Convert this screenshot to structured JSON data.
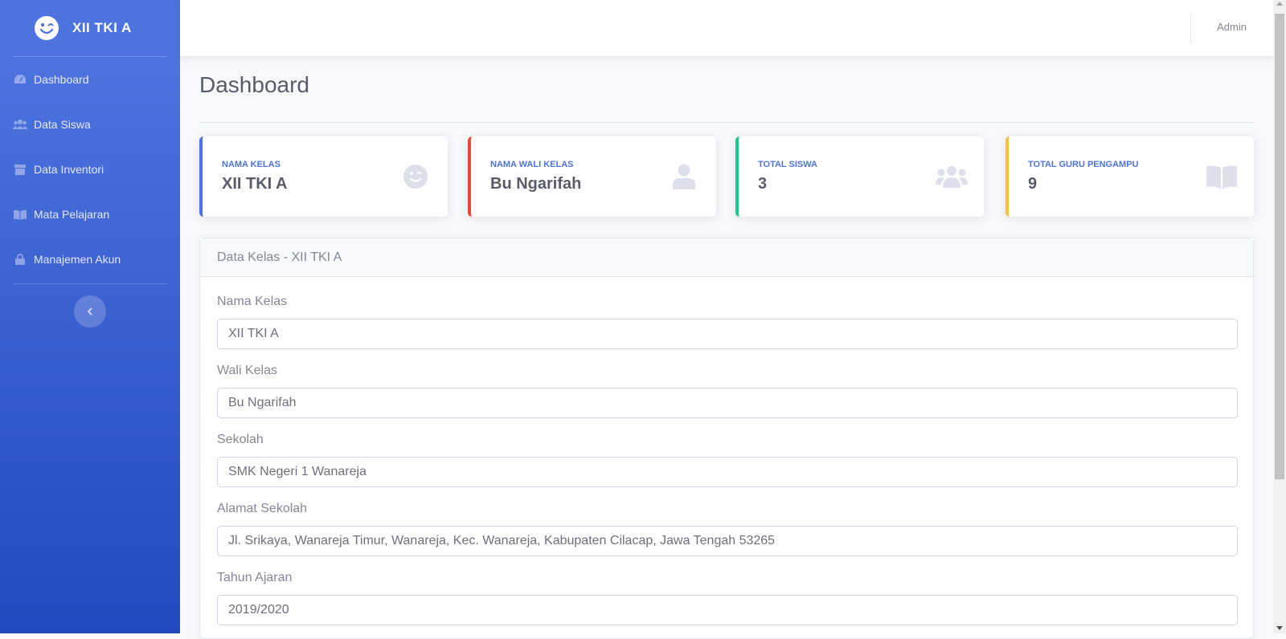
{
  "brand": {
    "title": "XII TKI A"
  },
  "sidebar": {
    "items": [
      {
        "label": "Dashboard",
        "icon": "gauge-icon"
      },
      {
        "label": "Data Siswa",
        "icon": "users-icon"
      },
      {
        "label": "Data Inventori",
        "icon": "box-icon"
      },
      {
        "label": "Mata Pelajaran",
        "icon": "book-icon"
      },
      {
        "label": "Manajemen Akun",
        "icon": "lock-icon"
      }
    ],
    "toggle_icon": "chevron-left-icon"
  },
  "topbar": {
    "user": "Admin"
  },
  "page": {
    "title": "Dashboard"
  },
  "cards": [
    {
      "label": "NAMA KELAS",
      "value": "XII TKI A",
      "color": "#4e73df",
      "icon": "smile-wink-icon"
    },
    {
      "label": "NAMA WALI KELAS",
      "value": "Bu Ngarifah",
      "color": "#e74a3b",
      "icon": "user-icon"
    },
    {
      "label": "TOTAL SISWA",
      "value": "3",
      "color": "#1cc88a",
      "icon": "users-icon"
    },
    {
      "label": "TOTAL GURU PENGAMPU",
      "value": "9",
      "color": "#f6c23e",
      "icon": "book-open-icon"
    }
  ],
  "panel": {
    "title": "Data Kelas - XII TKI A",
    "fields": [
      {
        "label": "Nama Kelas",
        "value": "XII TKI A"
      },
      {
        "label": "Wali Kelas",
        "value": "Bu Ngarifah"
      },
      {
        "label": "Sekolah",
        "value": "SMK Negeri 1 Wanareja"
      },
      {
        "label": "Alamat Sekolah",
        "value": "Jl. Srikaya, Wanareja Timur, Wanareja, Kec. Wanareja, Kabupaten Cilacap, Jawa Tengah 53265"
      },
      {
        "label": "Tahun Ajaran",
        "value": "2019/2020"
      }
    ]
  }
}
